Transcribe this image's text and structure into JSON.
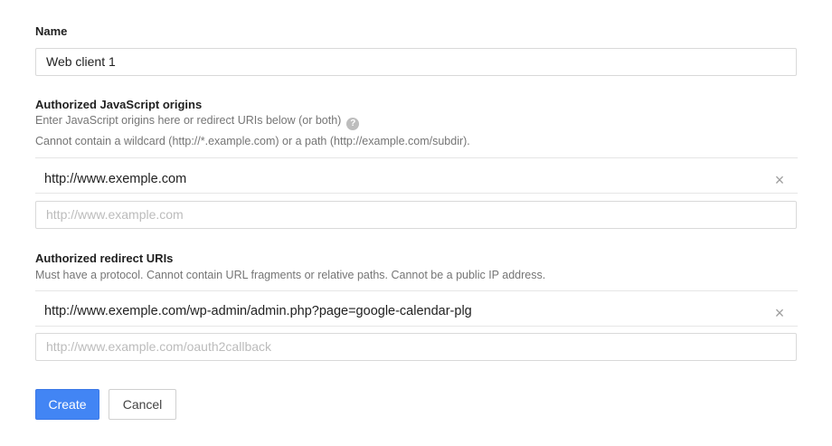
{
  "name_section": {
    "label": "Name",
    "value": "Web client 1"
  },
  "js_origins": {
    "label": "Authorized JavaScript origins",
    "help_line1": "Enter JavaScript origins here or redirect URIs below (or both)",
    "help_icon": "?",
    "help_line2": "Cannot contain a wildcard (http://*.example.com) or a path (http://example.com/subdir).",
    "entries": [
      "http://www.exemple.com"
    ],
    "placeholder": "http://www.example.com"
  },
  "redirect_uris": {
    "label": "Authorized redirect URIs",
    "help_line1": "Must have a protocol. Cannot contain URL fragments or relative paths. Cannot be a public IP address.",
    "entries": [
      "http://www.exemple.com/wp-admin/admin.php?page=google-calendar-plg"
    ],
    "placeholder": "http://www.example.com/oauth2callback"
  },
  "remove_glyph": "×",
  "actions": {
    "create_label": "Create",
    "cancel_label": "Cancel"
  },
  "colors": {
    "primary": "#4285f4",
    "placeholder_text": "#bcbcbc",
    "help_text": "#757575"
  }
}
